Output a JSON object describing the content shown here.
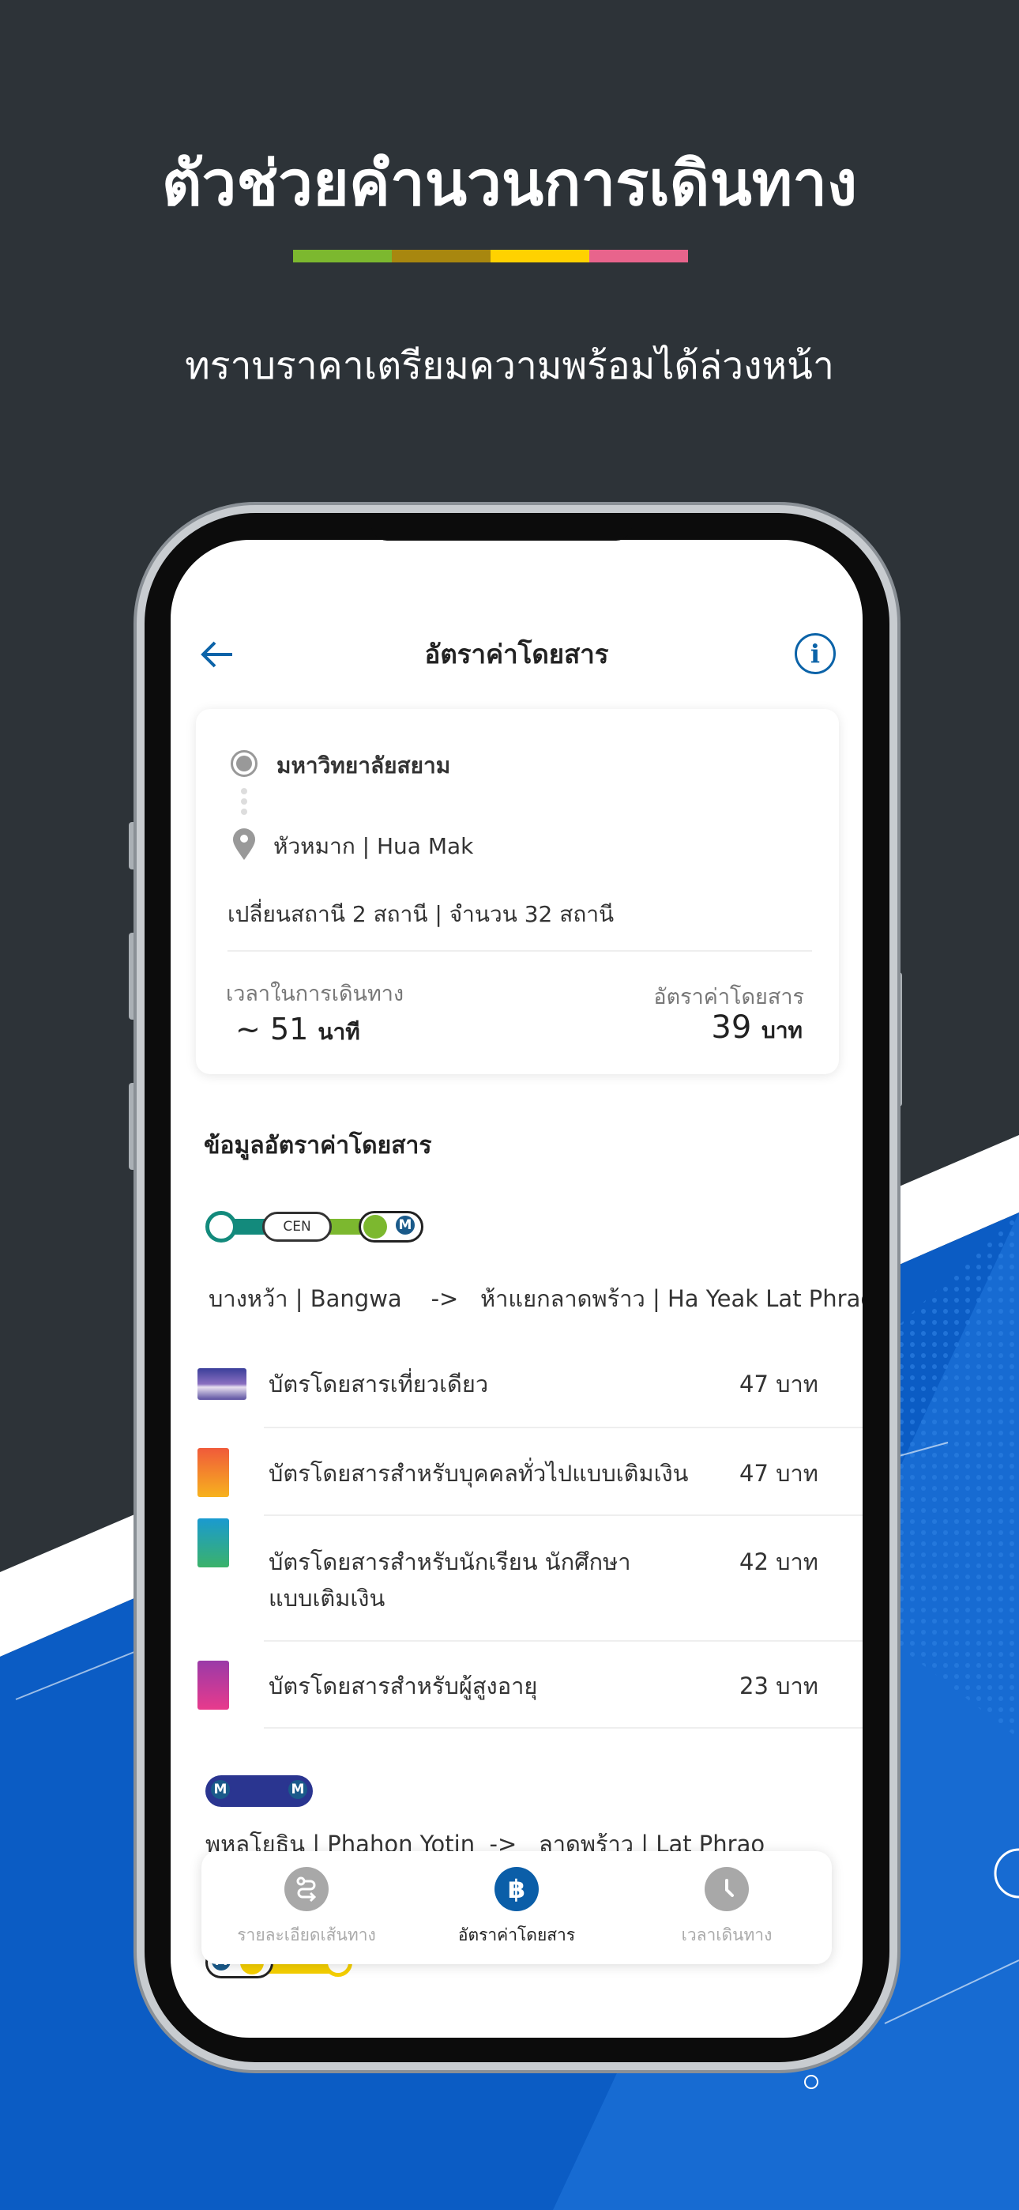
{
  "promo": {
    "headline": "ตัวช่วยคำนวนการเดินทาง",
    "subtitle": "ทราบราคาเตรียมความพร้อมได้ล่วงหน้า",
    "bar_colors": [
      "#7cb82f",
      "#a8870f",
      "#ffd200",
      "#e8648c"
    ]
  },
  "header": {
    "title": "อัตราค่าโดยสาร",
    "back_icon": "arrow-left-icon",
    "info_icon": "info-icon",
    "accent": "#0b63a8"
  },
  "summary": {
    "origin": "มหาวิทยาลัยสยาม",
    "destination": "หัวหมาก | Hua Mak",
    "transfers": "เปลี่ยนสถานี 2 สถานี | จำนวน 32 สถานี",
    "time_label": "เวลาในการเดินทาง",
    "time_prefix": "~",
    "time_value": "51",
    "time_unit": "นาที",
    "fare_label": "อัตราค่าโดยสาร",
    "fare_value": "39",
    "fare_unit": "บาท"
  },
  "fare_info": {
    "heading": "ข้อมูลอัตราค่าโดยสาร",
    "segments": [
      {
        "badge": "CEN",
        "badge_right": "M",
        "from": "บางหว้า | Bangwa",
        "arrow": "->",
        "to": "ห้าแยกลาดพร้าว | Ha Yeak Lat Phrao",
        "fares": [
          {
            "name": "บัตรโดยสารเที่ยวเดียว",
            "price": "47 บาท"
          },
          {
            "name": "บัตรโดยสารสำหรับบุคคลทั่วไปแบบเติมเงิน",
            "price": "47 บาท"
          },
          {
            "name": "บัตรโดยสารสำหรับนักเรียน นักศึกษา",
            "name2": "แบบเติมเงิน",
            "price": "42 บาท"
          },
          {
            "name": "บัตรโดยสารสำหรับผู้สูงอายุ",
            "price": "23 บาท"
          }
        ]
      },
      {
        "badge_left": "M",
        "badge_right": "M",
        "from": "พหลโยธิน | Phahon Yotin",
        "arrow": "->",
        "to": "ลาดพร้าว | Lat Phrao"
      },
      {
        "badge_left": "M"
      }
    ]
  },
  "bottom_nav": [
    {
      "label": "รายละเอียดเส้นทาง",
      "icon": "route-icon",
      "active": false
    },
    {
      "label": "อัตราค่าโดยสาร",
      "icon": "baht-icon",
      "glyph": "฿",
      "active": true
    },
    {
      "label": "เวลาเดินทาง",
      "icon": "clock-icon",
      "active": false
    }
  ]
}
